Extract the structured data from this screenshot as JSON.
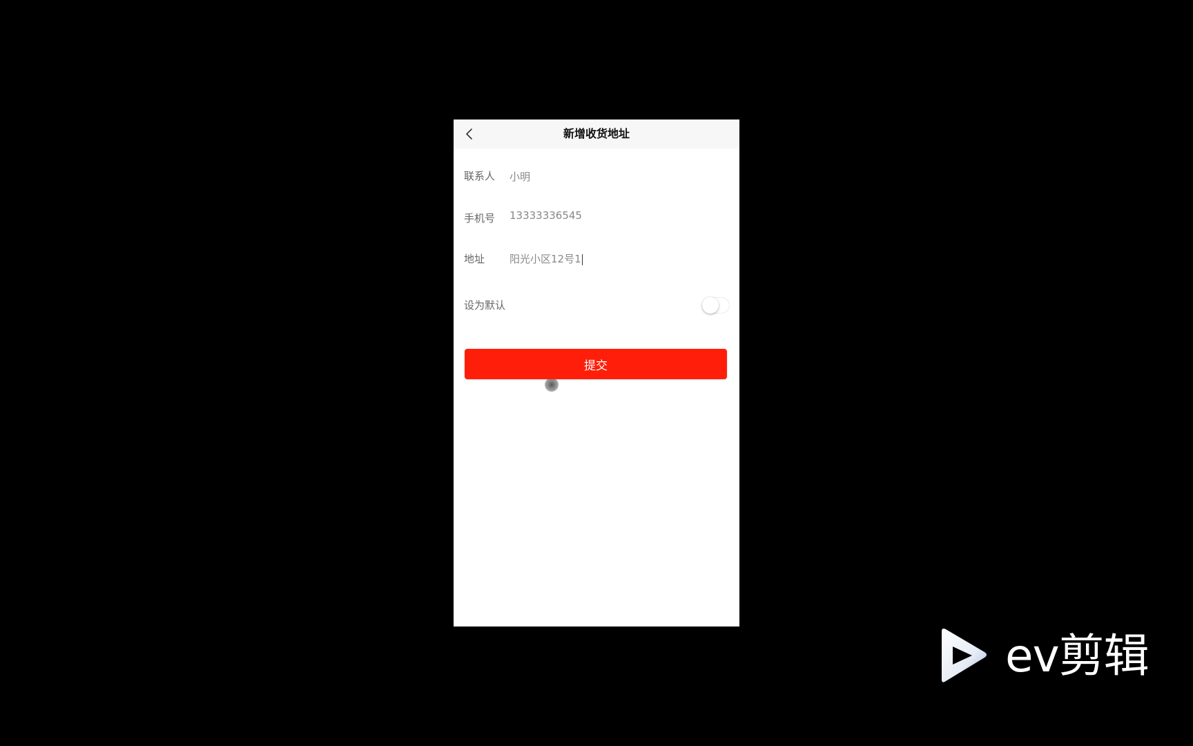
{
  "header": {
    "title": "新增收货地址",
    "back_icon": "chevron-left-icon"
  },
  "form": {
    "contact": {
      "label": "联系人",
      "value": "小明"
    },
    "phone": {
      "label": "手机号",
      "value": "13333336545"
    },
    "address": {
      "label": "地址",
      "value": "阳光小区12号1"
    },
    "default": {
      "label": "设为默认",
      "checked": false
    }
  },
  "submit": {
    "label": "提交"
  },
  "colors": {
    "accent": "#ff1e0a",
    "navbar_bg": "#f7f7f7",
    "label": "#666666",
    "value": "#888888"
  },
  "watermark": {
    "text": "ev剪辑"
  }
}
